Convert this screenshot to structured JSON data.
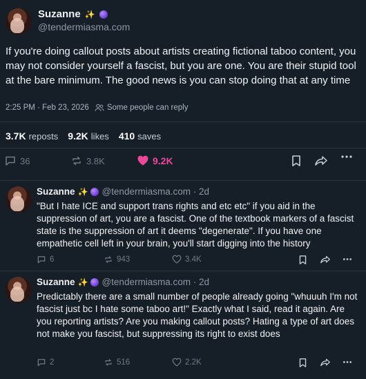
{
  "post": {
    "author": "Suzanne",
    "handle": "@tendermiasma.com",
    "text": "If you're doing callout posts about artists creating fictional taboo content, you may not consider yourself a fascist, but you are one. You are their stupid tool at the bare minimum. The good news is you can stop doing that at any time",
    "timestamp": "2:25 PM · Feb 23, 2026",
    "reply_setting": "Some people can reply",
    "reposts_count": "3.7K",
    "reposts_label": "reposts",
    "likes_count": "9.2K",
    "likes_label": "likes",
    "saves_count": "410",
    "saves_label": "saves",
    "reply_count": "36",
    "repost_count": "3.8K",
    "like_count": "9.2K",
    "colors": {
      "like": "#ec4899",
      "bg": "#161e27"
    },
    "icons": [
      "reply-icon",
      "repost-icon",
      "heart-icon",
      "bookmark-icon",
      "share-icon",
      "more-icon"
    ]
  },
  "replies": [
    {
      "author": "Suzanne",
      "handle_time": "@tendermiasma.com · 2d",
      "text": "\"But I hate ICE and support trans rights and etc etc\" if you aid in the suppression of art, you are a fascist. One of the textbook markers of a fascist state is the suppression of art it deems \"degenerate\". If you have one empathetic cell left in your brain, you'll start digging into the history",
      "reply_count": "6",
      "repost_count": "943",
      "like_count": "3.4K"
    },
    {
      "author": "Suzanne",
      "handle_time": "@tendermiasma.com · 2d",
      "text": "Predictably there are a small number of people already going \"whuuuh I'm not fascist just bc I hate some taboo art!\" Exactly what I said, read it again. Are you reporting artists? Are you making callout posts? Hating a type of art does not make you fascist, but suppressing its right to exist does",
      "reply_count": "2",
      "repost_count": "516",
      "like_count": "2.2K"
    }
  ]
}
